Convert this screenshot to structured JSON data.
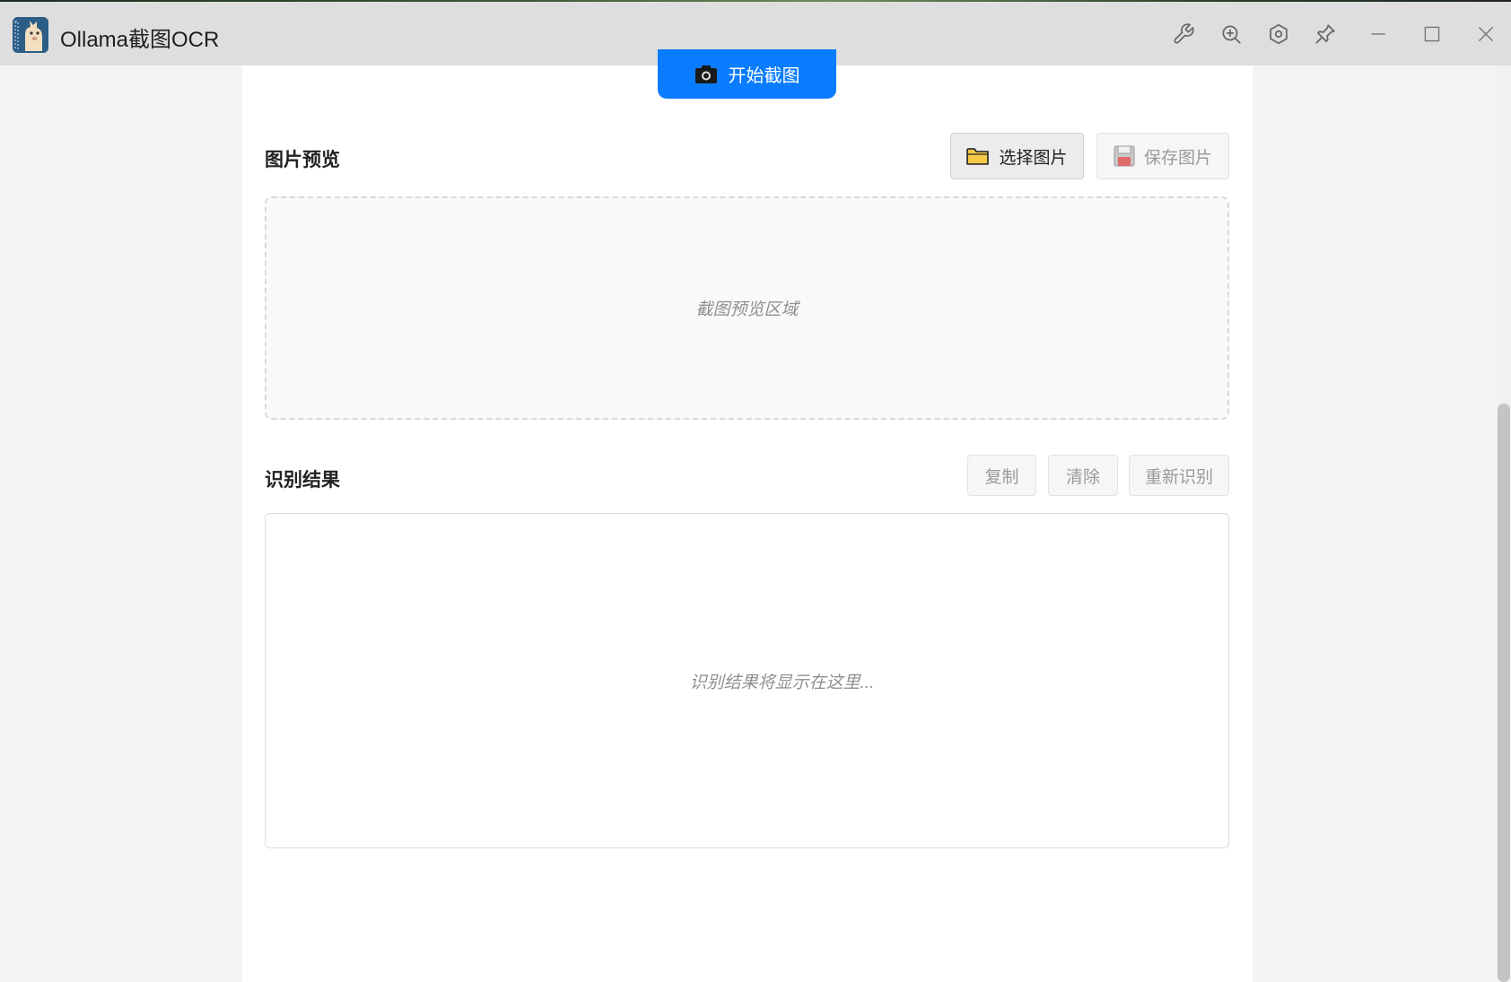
{
  "window": {
    "title": "Ollama截图OCR",
    "toolbar_icons": [
      "wrench-icon",
      "zoom-in-icon",
      "settings-icon",
      "pin-icon",
      "minimize-icon",
      "maximize-icon",
      "close-icon"
    ]
  },
  "capture": {
    "label": "开始截图",
    "icon": "camera-icon"
  },
  "preview": {
    "title": "图片预览",
    "select_label": "选择图片",
    "save_label": "保存图片",
    "placeholder": "截图预览区域"
  },
  "result": {
    "title": "识别结果",
    "copy_label": "复制",
    "clear_label": "清除",
    "retry_label": "重新识别",
    "placeholder": "识别结果将显示在这里..."
  },
  "colors": {
    "accent": "#0a7cff",
    "titlebar": "#dedede",
    "background": "#f4f4f4"
  }
}
